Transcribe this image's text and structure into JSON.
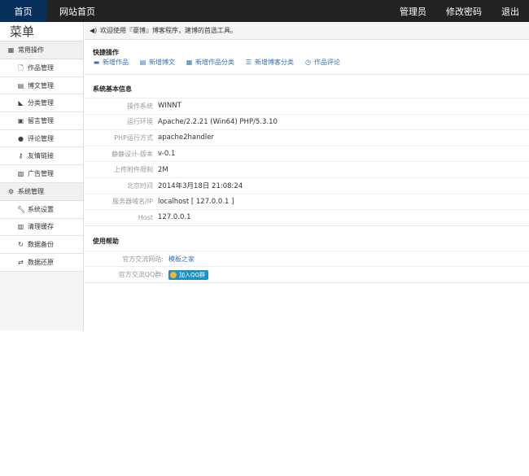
{
  "topnav": {
    "home_tab": "首页",
    "site_home": "网站首页",
    "admin": "管理员",
    "change_password": "修改密码",
    "logout": "退出"
  },
  "sidebar": {
    "title": "菜单",
    "common_group": "常用操作",
    "common_items": [
      "作品管理",
      "博文管理",
      "分类管理",
      "留言管理",
      "评论管理",
      "友情链接",
      "广告管理"
    ],
    "system_group": "系统管理",
    "system_items": [
      "系统设置",
      "清理缓存",
      "数据备份",
      "数据还原"
    ]
  },
  "notice": "欢迎使用『豪博』博客程序，建博的首选工具。",
  "quick": {
    "title": "快捷操作",
    "links": [
      "新增作品",
      "新增博文",
      "新增作品分类",
      "新增博客分类",
      "作品评论"
    ]
  },
  "info": {
    "title": "系统基本信息",
    "rows": [
      {
        "label": "操作系统",
        "value": "WINNT"
      },
      {
        "label": "运行环境",
        "value": "Apache/2.2.21 (Win64) PHP/5.3.10"
      },
      {
        "label": "PHP运行方式",
        "value": "apache2handler"
      },
      {
        "label": "静静设计-版本",
        "value": "v-0.1"
      },
      {
        "label": "上传附件限制",
        "value": "2M"
      },
      {
        "label": "北京时间",
        "value": "2014年3月18日 21:08:24"
      },
      {
        "label": "服务器域名/IP",
        "value": "localhost [ 127.0.0.1 ]"
      },
      {
        "label": "Host",
        "value": "127.0.0.1"
      }
    ]
  },
  "help": {
    "title": "使用帮助",
    "site_label": "官方交流网站:",
    "site_link": "模板之家",
    "qq_label": "官方交流QQ群:",
    "qq_button": "加入QQ群"
  }
}
